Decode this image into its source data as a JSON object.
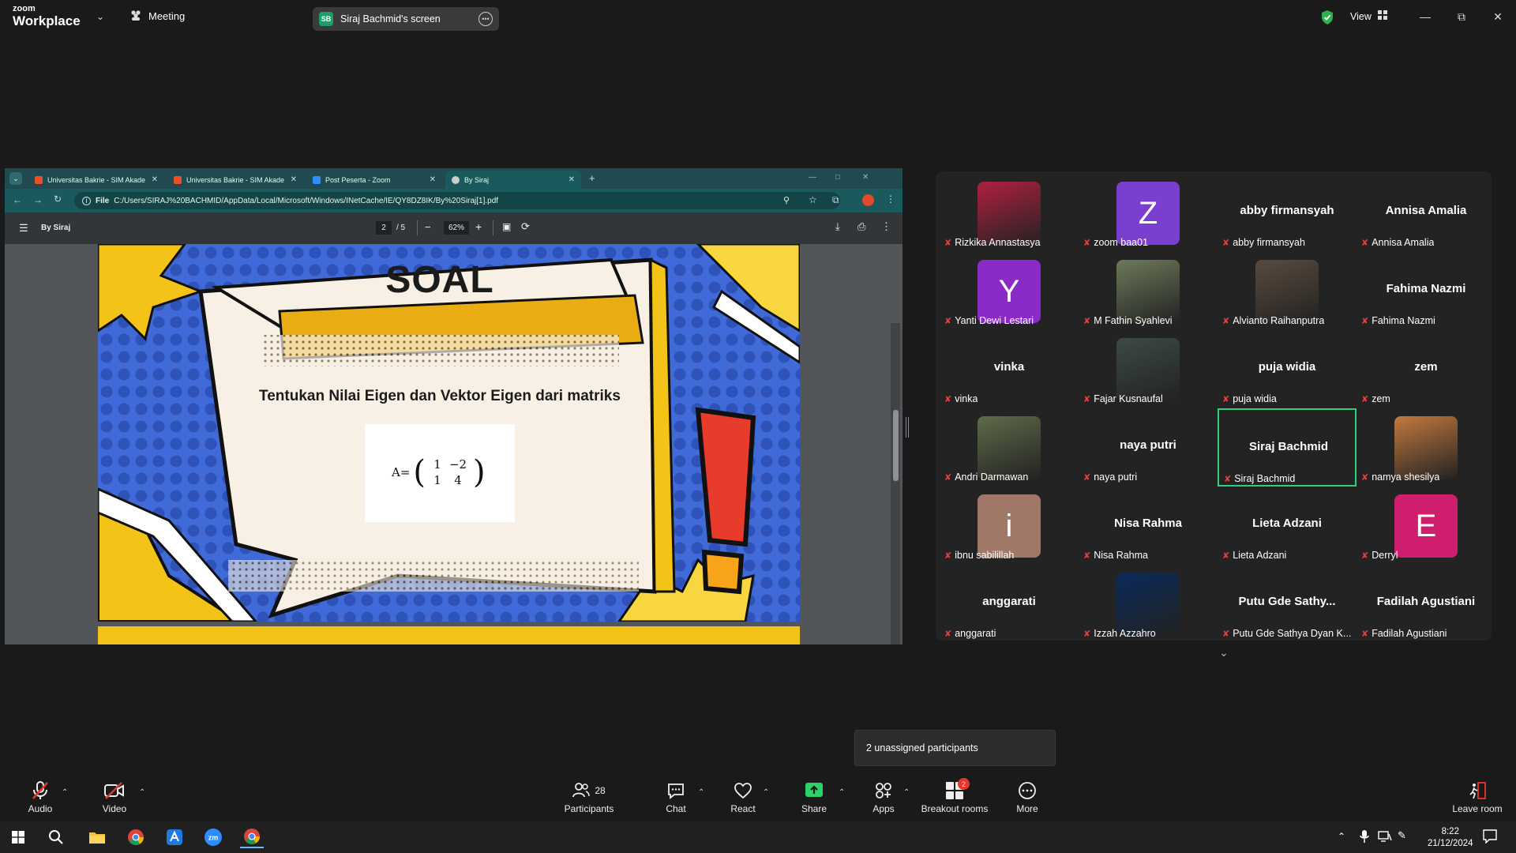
{
  "zoom": {
    "logo_small": "zoom",
    "logo_big": "Workplace",
    "meeting_label": "Meeting",
    "screen_pill_initials": "SB",
    "screen_pill_label": "Siraj Bachmid's screen",
    "view_label": "View"
  },
  "browser": {
    "tabs": [
      {
        "label": "Universitas Bakrie - SIM Akade",
        "color": "#e8502a"
      },
      {
        "label": "Universitas Bakrie - SIM Akade",
        "color": "#e8502a"
      },
      {
        "label": "Post Peserta - Zoom",
        "color": "#2d8cff"
      },
      {
        "label": "By Siraj",
        "color": "#cccccc"
      }
    ],
    "url_scheme": "File",
    "url": "C:/Users/SIRAJ%20BACHMID/AppData/Local/Microsoft/Windows/INetCache/IE/QY8DZ8IK/By%20Siraj[1].pdf",
    "pdf_title": "By Siraj",
    "page_current": "2",
    "page_total": "/ 5",
    "zoom_level": "62%"
  },
  "slide": {
    "title": "SOAL",
    "question": "Tentukan Nilai Eigen dan Vektor Eigen dari matriks",
    "matrix_label": "A=",
    "matrix": [
      [
        "1",
        "−2"
      ],
      [
        "1",
        "4"
      ]
    ]
  },
  "gallery": {
    "participants": [
      {
        "name": "Rizkika Annastasya",
        "kind": "photo",
        "color": "#b02040"
      },
      {
        "name": "zoom baa01",
        "kind": "letter",
        "letter": "Z",
        "color": "#7b3fd0"
      },
      {
        "name": "abby firmansyah",
        "kind": "text"
      },
      {
        "name": "Annisa Amalia",
        "kind": "text"
      },
      {
        "name": "Yanti Dewi Lestari",
        "kind": "letter",
        "letter": "Y",
        "color": "#8a2bc8"
      },
      {
        "name": "M Fathin Syahlevi",
        "kind": "photo",
        "color": "#6e7a5a"
      },
      {
        "name": "Alvianto Raihanputra",
        "kind": "photo",
        "color": "#5a4a3e"
      },
      {
        "name": "Fahima Nazmi",
        "kind": "text"
      },
      {
        "name": "vinka",
        "kind": "text"
      },
      {
        "name": "Fajar Kusnaufal",
        "kind": "photo",
        "color": "#3d4a44"
      },
      {
        "name": "puja widia",
        "kind": "text"
      },
      {
        "name": "zem",
        "kind": "text"
      },
      {
        "name": "Andri Darmawan",
        "kind": "photo",
        "color": "#5f6b4a"
      },
      {
        "name": "naya putri",
        "kind": "text"
      },
      {
        "name": "Siraj Bachmid",
        "kind": "text",
        "active": true
      },
      {
        "name": "namya shesilya",
        "kind": "photo",
        "color": "#c27a3e"
      },
      {
        "name": "ibnu sabilillah",
        "kind": "letter",
        "letter": "i",
        "color": "#a07868"
      },
      {
        "name": "Nisa Rahma",
        "kind": "text"
      },
      {
        "name": "Lieta Adzani",
        "kind": "text"
      },
      {
        "name": "Derryl",
        "kind": "letter",
        "letter": "E",
        "color": "#d01e6e"
      },
      {
        "name": "anggarati",
        "kind": "text"
      },
      {
        "name": "Izzah Azzahro",
        "kind": "photo",
        "color": "#0a2a5a"
      },
      {
        "name": "Putu Gde Sathya Dyan K...",
        "bigname": "Putu Gde Sathy...",
        "kind": "text"
      },
      {
        "name": "Fadilah Agustiani",
        "kind": "text"
      }
    ]
  },
  "unassigned": "2 unassigned participants",
  "toolbar": {
    "audio": "Audio",
    "video": "Video",
    "participants": "Participants",
    "participants_count": "28",
    "chat": "Chat",
    "react": "React",
    "share": "Share",
    "apps": "Apps",
    "breakout": "Breakout rooms",
    "breakout_badge": "2",
    "more": "More",
    "leave": "Leave room"
  },
  "taskbar": {
    "time": "8:22",
    "date": "21/12/2024"
  }
}
